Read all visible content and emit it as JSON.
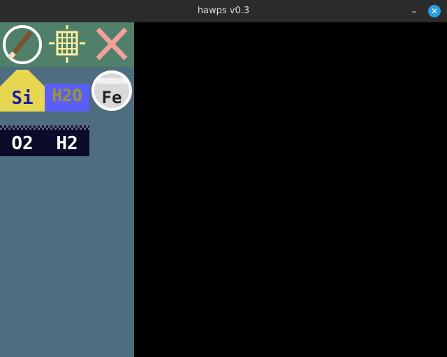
{
  "window": {
    "title": "hawps v0.3",
    "minimize_label": "–",
    "close_label": "✕"
  },
  "colors": {
    "titlebar": "#2b2b2b",
    "sidebar": "#4e6d7f",
    "toolbar": "#508069",
    "si_tile": "#e7d64f",
    "si_text": "#1a1ab5",
    "h2o_tile": "#5b5ff5",
    "h2o_text": "#9a9a25",
    "fe_circle": "#d9d9d9",
    "accent_close": "#2a9ee2",
    "eraser_x": "#f2a0a0",
    "grid_icon": "#fff2a0"
  },
  "tools": [
    {
      "name": "brush",
      "icon": "brush-icon"
    },
    {
      "name": "grid",
      "icon": "grid-icon"
    },
    {
      "name": "clear",
      "icon": "x-icon"
    }
  ],
  "elements": {
    "si": "Si",
    "h2o": "H2O",
    "fe": "Fe"
  },
  "gases": {
    "o2": "O2",
    "h2": "H2"
  }
}
